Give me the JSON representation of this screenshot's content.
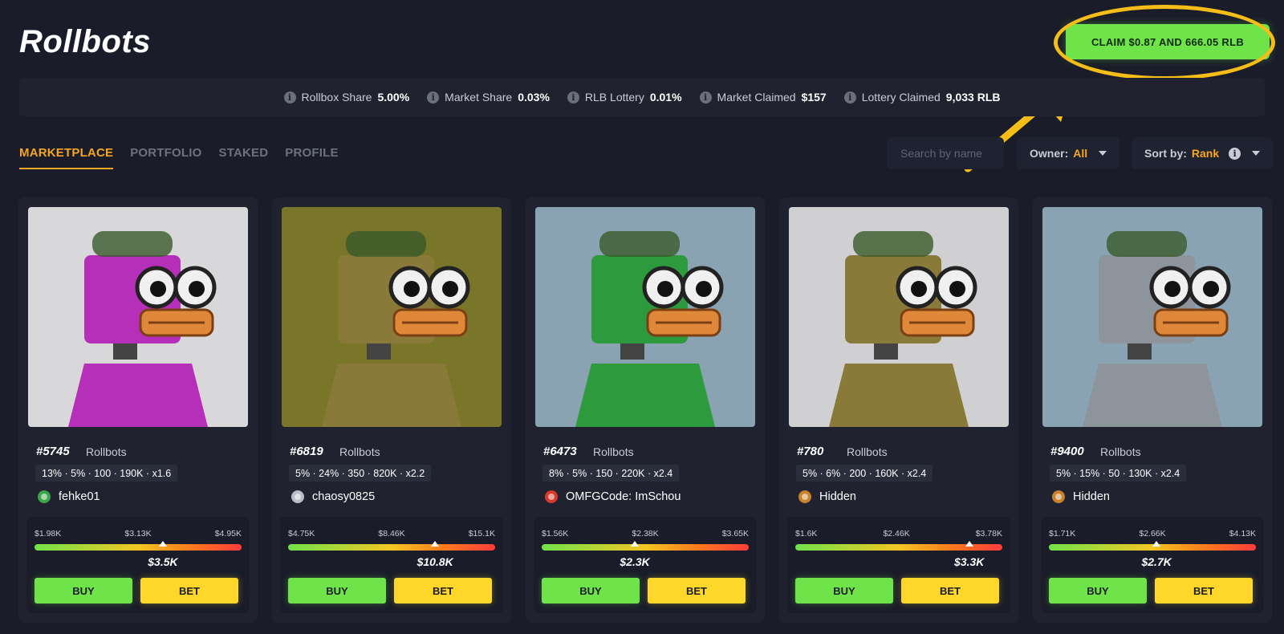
{
  "header": {
    "title": "Rollbots",
    "claim_label": "CLAIM $0.87 AND 666.05 RLB"
  },
  "stats": [
    {
      "label": "Rollbox Share",
      "value": "5.00%"
    },
    {
      "label": "Market Share",
      "value": "0.03%"
    },
    {
      "label": "RLB Lottery",
      "value": "0.01%"
    },
    {
      "label": "Market Claimed",
      "value": "$157"
    },
    {
      "label": "Lottery Claimed",
      "value": "9,033 RLB"
    }
  ],
  "tabs": [
    {
      "label": "MARKETPLACE",
      "active": true
    },
    {
      "label": "PORTFOLIO"
    },
    {
      "label": "STAKED"
    },
    {
      "label": "PROFILE"
    }
  ],
  "search": {
    "placeholder": "Search by name"
  },
  "owner_filter": {
    "label": "Owner:",
    "value": "All"
  },
  "sort": {
    "label": "Sort by:",
    "value": "Rank"
  },
  "cards": [
    {
      "id": "#5745",
      "collection": "Rollbots",
      "traits": "13% · 5% · 100 · 190K · x1.6",
      "owner": "fehke01",
      "owner_icon": "green-badge-icon",
      "min": "$1.98K",
      "mid": "$3.13K",
      "max": "$4.95K",
      "price": "$3.5K",
      "level": 0.62,
      "bg": "#d8d8da",
      "body": "#b52fb8",
      "buy": "BUY",
      "bet": "BET"
    },
    {
      "id": "#6819",
      "collection": "Rollbots",
      "traits": "5% · 24% · 350 · 820K · x2.2",
      "owner": "chaosy0825",
      "owner_icon": "avatar-icon",
      "min": "$4.75K",
      "mid": "$8.46K",
      "max": "$15.1K",
      "price": "$10.8K",
      "level": 0.71,
      "bg": "#7a7629",
      "body": "#8a7a3a",
      "buy": "BUY",
      "bet": "BET"
    },
    {
      "id": "#6473",
      "collection": "Rollbots",
      "traits": "8% · 5% · 150 · 220K · x2.4",
      "owner": "OMFGCode: ImSchou",
      "owner_icon": "red-badge-icon",
      "min": "$1.56K",
      "mid": "$2.38K",
      "max": "$3.65K",
      "price": "$2.3K",
      "level": 0.45,
      "bg": "#8aa3b2",
      "body": "#2e9a3e",
      "buy": "BUY",
      "bet": "BET"
    },
    {
      "id": "#780",
      "collection": "Rollbots",
      "traits": "5% · 6% · 200 · 160K · x2.4",
      "owner": "Hidden",
      "owner_icon": "hidden-badge-icon",
      "min": "$1.6K",
      "mid": "$2.46K",
      "max": "$3.78K",
      "price": "$3.3K",
      "level": 0.84,
      "bg": "#d0d0d3",
      "body": "#8a7a3a",
      "buy": "BUY",
      "bet": "BET"
    },
    {
      "id": "#9400",
      "collection": "Rollbots",
      "traits": "5% · 15% · 50 · 130K · x2.4",
      "owner": "Hidden",
      "owner_icon": "hidden-badge-icon",
      "min": "$1.71K",
      "mid": "$2.66K",
      "max": "$4.13K",
      "price": "$2.7K",
      "level": 0.52,
      "bg": "#8aa3b2",
      "body": "#8e949c",
      "buy": "BUY",
      "bet": "BET"
    }
  ]
}
